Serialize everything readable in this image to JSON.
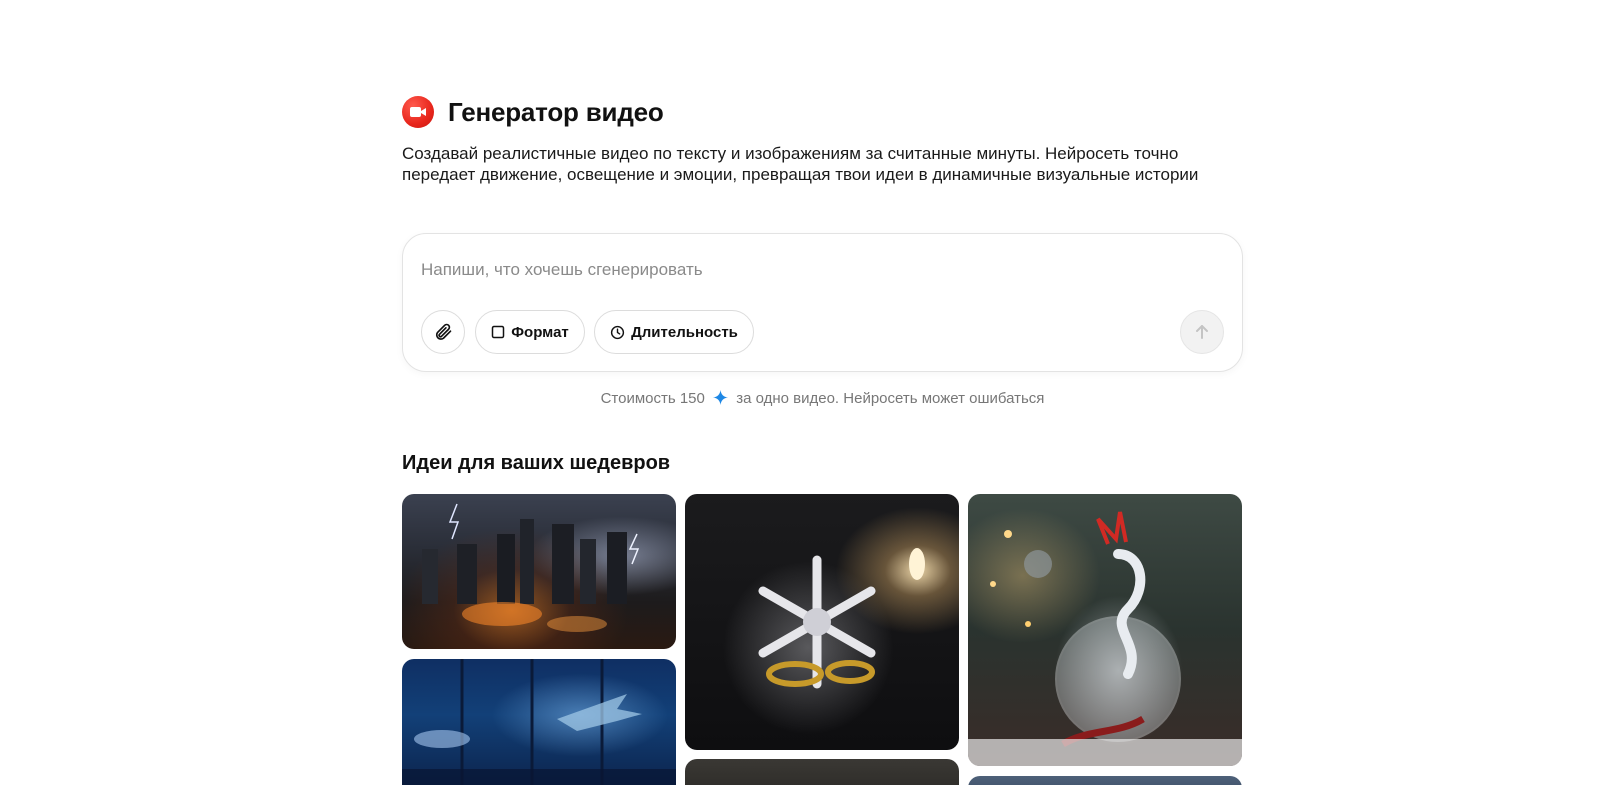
{
  "header": {
    "title": "Генератор видео",
    "icon": "video-camera-icon",
    "accent_color": "#e8261c"
  },
  "description": "Создавай реалистичные видео по тексту и изображениям за считанные минуты. Нейросеть точно передает движение, освещение и эмоции, превращая твои идеи в динамичные визуальные истории",
  "composer": {
    "placeholder": "Напиши, что хочешь сгенерировать",
    "value": "",
    "attach_icon": "paperclip-icon",
    "format_label": "Формат",
    "format_icon": "square-icon",
    "duration_label": "Длительность",
    "duration_icon": "clock-icon",
    "send_icon": "arrow-up-icon"
  },
  "cost": {
    "prefix": "Стоимость 150",
    "suffix": "за одно видео. Нейросеть может ошибаться",
    "currency_icon": "sparkle-icon",
    "currency_color": "#1e88e5"
  },
  "ideas": {
    "title": "Идеи для ваших шедевров"
  }
}
